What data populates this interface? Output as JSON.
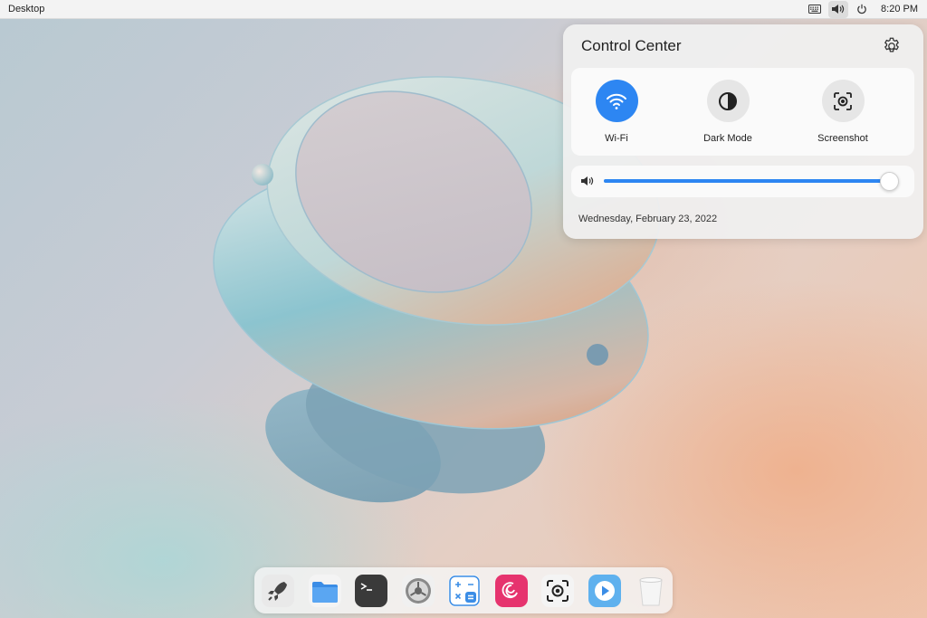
{
  "topbar": {
    "title": "Desktop",
    "clock": "8:20 PM",
    "icons": [
      "keyboard-icon",
      "volume-icon",
      "power-icon"
    ]
  },
  "control_center": {
    "title": "Control Center",
    "tiles": [
      {
        "label": "Wi-Fi",
        "icon": "wifi-icon",
        "active": true
      },
      {
        "label": "Dark Mode",
        "icon": "dark-mode-icon",
        "active": false
      },
      {
        "label": "Screenshot",
        "icon": "screenshot-icon",
        "active": false
      }
    ],
    "volume": {
      "level": 0.99
    },
    "date": "Wednesday, February 23, 2022"
  },
  "dock": {
    "items": [
      "launcher-icon",
      "file-manager-icon",
      "terminal-icon",
      "settings-icon",
      "calculator-icon",
      "debian-icon",
      "screenshot-app-icon",
      "media-player-icon",
      "trash-icon"
    ]
  },
  "colors": {
    "accent": "#2d86f2",
    "panel": "#f0f0f0"
  }
}
